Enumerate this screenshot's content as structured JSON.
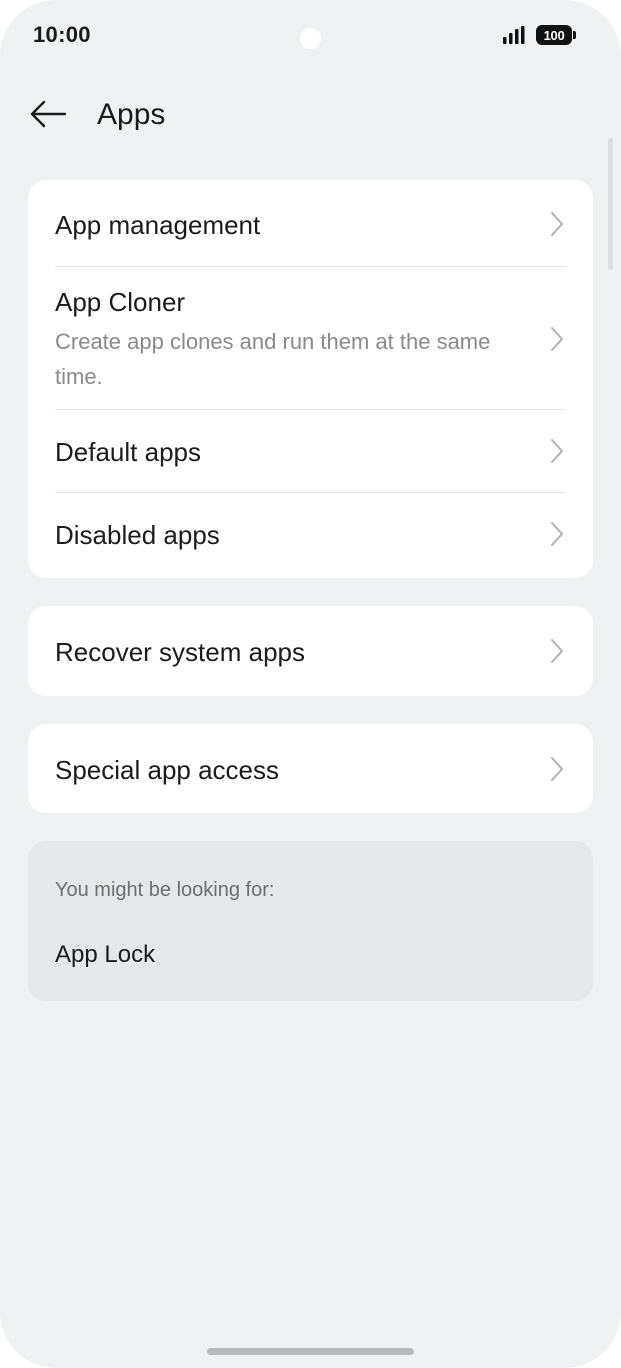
{
  "status_bar": {
    "time": "10:00",
    "battery": "100",
    "signal_icon": "signal-bars-icon",
    "battery_icon": "battery-icon"
  },
  "header": {
    "back_icon": "arrow-left-icon",
    "title": "Apps"
  },
  "group1": {
    "items": [
      {
        "title": "App management"
      },
      {
        "title": "App Cloner",
        "subtitle": "Create app clones and run them at the same time."
      },
      {
        "title": "Default apps"
      },
      {
        "title": "Disabled apps"
      }
    ]
  },
  "group2": {
    "items": [
      {
        "title": "Recover system apps"
      }
    ]
  },
  "group3": {
    "items": [
      {
        "title": "Special app access"
      }
    ]
  },
  "suggestions": {
    "label": "You might be looking for:",
    "items": [
      "App Lock"
    ]
  },
  "colors": {
    "background": "#f0f1f3",
    "card": "#ffffff",
    "suggest_card": "#e6e7e9",
    "text_primary": "#1c1c1c",
    "text_secondary": "#8a8a8e",
    "chevron": "#b0b0b4"
  }
}
